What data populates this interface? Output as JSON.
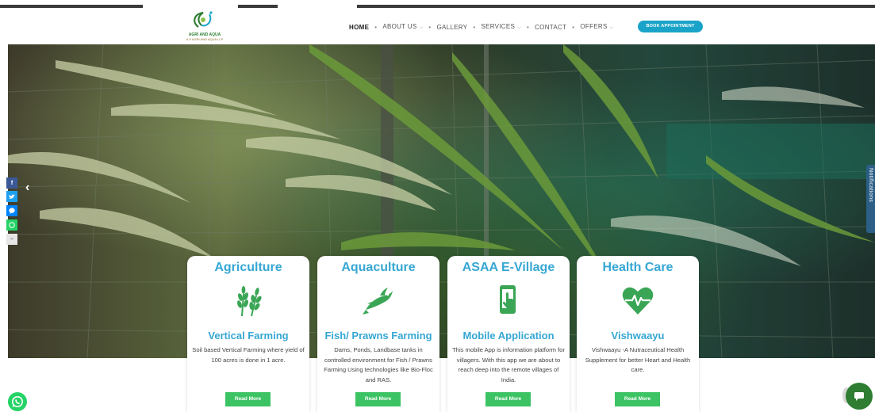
{
  "header": {
    "logo_title": "AGRI AND AQUA",
    "logo_subtitle": "A S AGRI AND AQUA LLP",
    "nav": {
      "home": "HOME",
      "about": "ABOUT US",
      "gallery": "GALLERY",
      "services": "SERVICES",
      "contact": "CONTACT",
      "offers": "OFFERS"
    },
    "book_button": "BOOK APPOINTMENT"
  },
  "hero": {
    "prev_arrow": "‹",
    "next_arrow": "›"
  },
  "side": {
    "notifications_label": "Notifications"
  },
  "cards": [
    {
      "title": "Agriculture",
      "icon": "wheat-icon",
      "subtitle": "Vertical Farming",
      "description": "Soil based Vertical Farming where yield of 100 acres is done in 1 acre.",
      "button": "Read More"
    },
    {
      "title": "Aquaculture",
      "icon": "fish-icon",
      "subtitle": "Fish/ Prawns Farming",
      "description": "Dams, Ponds, Landbase tanks in controlled environment for Fish / Prawns Farming Using technologies like Bio-Floc and RAS.",
      "button": "Read More"
    },
    {
      "title": "ASAA E-Village",
      "icon": "mobile-tap-icon",
      "subtitle": "Mobile Application",
      "description": "This mobile App is information platform for villagers. With this app we are about to reach deep into the remote villages of India.",
      "button": "Read More"
    },
    {
      "title": "Health Care",
      "icon": "heart-pulse-icon",
      "subtitle": "Vishwaayu",
      "description": "Vishwaayu -A Nutraceutical Health Supplement for better Heart and Health care.",
      "button": "Read More"
    }
  ],
  "colors": {
    "accent_blue": "#36a7d3",
    "button_green": "#3cc363",
    "icon_green": "#3aa655",
    "book_button": "#1aa3c8"
  }
}
